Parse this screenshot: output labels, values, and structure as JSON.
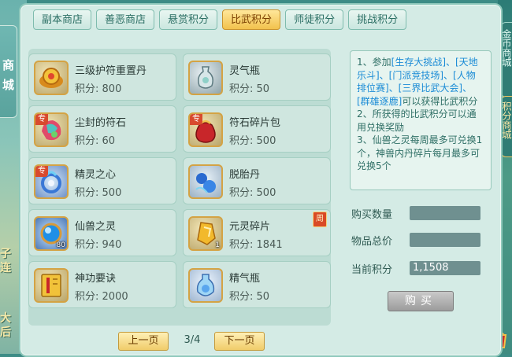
{
  "side_tab": {
    "label": "商城"
  },
  "left_fragments": [
    "子",
    "连",
    "大",
    "后"
  ],
  "right_tabs": [
    "金币商城",
    "积分商城"
  ],
  "tabs": [
    {
      "label": "副本商店",
      "active": false
    },
    {
      "label": "善恶商店",
      "active": false
    },
    {
      "label": "悬赏积分",
      "active": false
    },
    {
      "label": "比武积分",
      "active": true
    },
    {
      "label": "师徒积分",
      "active": false
    },
    {
      "label": "挑战积分",
      "active": false
    }
  ],
  "score_label": "积分:",
  "items": [
    {
      "name": "三级护符重置丹",
      "score": "800",
      "icon": "gold-pill-icon"
    },
    {
      "name": "灵气瓶",
      "score": "50",
      "icon": "vase-icon"
    },
    {
      "name": "尘封的符石",
      "score": "60",
      "icon": "colorful-stone-icon",
      "tag": "专"
    },
    {
      "name": "符石碎片包",
      "score": "500",
      "icon": "red-pouch-icon",
      "tag": "专"
    },
    {
      "name": "精灵之心",
      "score": "500",
      "icon": "spirit-heart-icon",
      "tag": "专"
    },
    {
      "name": "脱胎丹",
      "score": "500",
      "icon": "blue-orb-icon"
    },
    {
      "name": "仙兽之灵",
      "score": "940",
      "icon": "blue-sphere-icon",
      "count": "80"
    },
    {
      "name": "元灵碎片",
      "score": "1841",
      "icon": "gold-shard-icon",
      "count": "1",
      "badge": "周"
    },
    {
      "name": "神功要诀",
      "score": "2000",
      "icon": "scroll-book-icon"
    },
    {
      "name": "精气瓶",
      "score": "50",
      "icon": "blue-bottle-icon"
    }
  ],
  "description": {
    "line1_pre": "1、参加",
    "line1_hl": "[生存大挑战]、[天地乐斗]、[门派竞技场]、[人物排位赛]、[三界比武大会]、[群雄逐鹿]",
    "line1_post": "可以获得比武积分",
    "line2": "2、所获得的比武积分可以通用兑换奖励",
    "line3": "3、仙兽之灵每周最多可兑换1个，神兽内丹碎片每月最多可兑换5个"
  },
  "purchase": {
    "qty_label": "购买数量",
    "qty_value": "",
    "total_label": "物品总价",
    "total_value": "",
    "current_label": "当前积分",
    "current_value": "1,1508",
    "buy_label": "购买"
  },
  "pager": {
    "prev_label": "上一页",
    "page_text": "3/4",
    "next_label": "下一页"
  },
  "colors": {
    "panel_bg": "#d4ebe5",
    "active_tab": "#f2c24d",
    "highlight_text": "#1a8bd6",
    "desc_text": "#2f6f66"
  }
}
